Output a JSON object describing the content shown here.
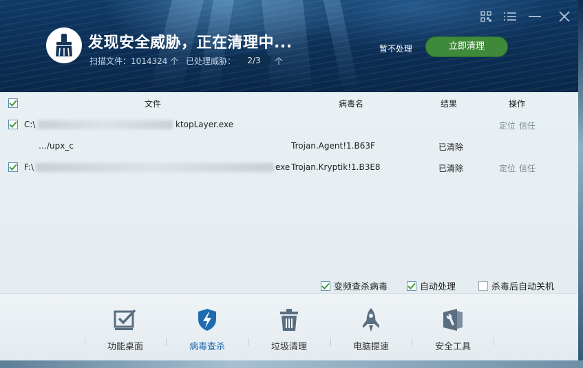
{
  "header": {
    "title": "发现安全威胁，正在清理中...",
    "scanned_label": "扫描文件：1014324 个",
    "processed_label": "已处理威胁：",
    "processed_value": "2/3",
    "processed_unit": "个",
    "ignore_label": "暂不处理",
    "clean_label": "立即清理",
    "clean_color": "#3f8a3a"
  },
  "window_controls": [
    "qrcode-icon",
    "menu-icon",
    "minimize-icon",
    "close-icon"
  ],
  "table": {
    "columns": [
      "文件",
      "病毒名",
      "结果",
      "操作"
    ],
    "rows": [
      {
        "checked": true,
        "file_start": "C:\\",
        "file_end": "ktopLayer.exe",
        "virus": "",
        "result": "",
        "locate": "定位",
        "trust": "信任"
      },
      {
        "checked": null,
        "file_start": "…/upx_c",
        "file_end": "",
        "virus": "Trojan.Agent!1.B63F",
        "result": "已清除",
        "locate": "",
        "trust": ""
      },
      {
        "checked": true,
        "file_start": "F:\\",
        "file_end": "exe",
        "virus": "Trojan.Kryptik!1.B3E8",
        "result": "已清除",
        "locate": "定位",
        "trust": "信任"
      }
    ]
  },
  "options": [
    {
      "label": "变频查杀病毒",
      "checked": true
    },
    {
      "label": "自动处理",
      "checked": true
    },
    {
      "label": "杀毒后自动关机",
      "checked": false
    }
  ],
  "toolbar": [
    {
      "label": "功能桌面",
      "icon": "desktop-check-icon",
      "active": false
    },
    {
      "label": "病毒查杀",
      "icon": "shield-lightning-icon",
      "active": true
    },
    {
      "label": "垃圾清理",
      "icon": "trash-icon",
      "active": false
    },
    {
      "label": "电脑提速",
      "icon": "rocket-icon",
      "active": false
    },
    {
      "label": "安全工具",
      "icon": "wrench-tools-icon",
      "active": false
    }
  ],
  "colors": {
    "accent_blue": "#1e6bb0",
    "check_green": "#3f9a3a"
  }
}
